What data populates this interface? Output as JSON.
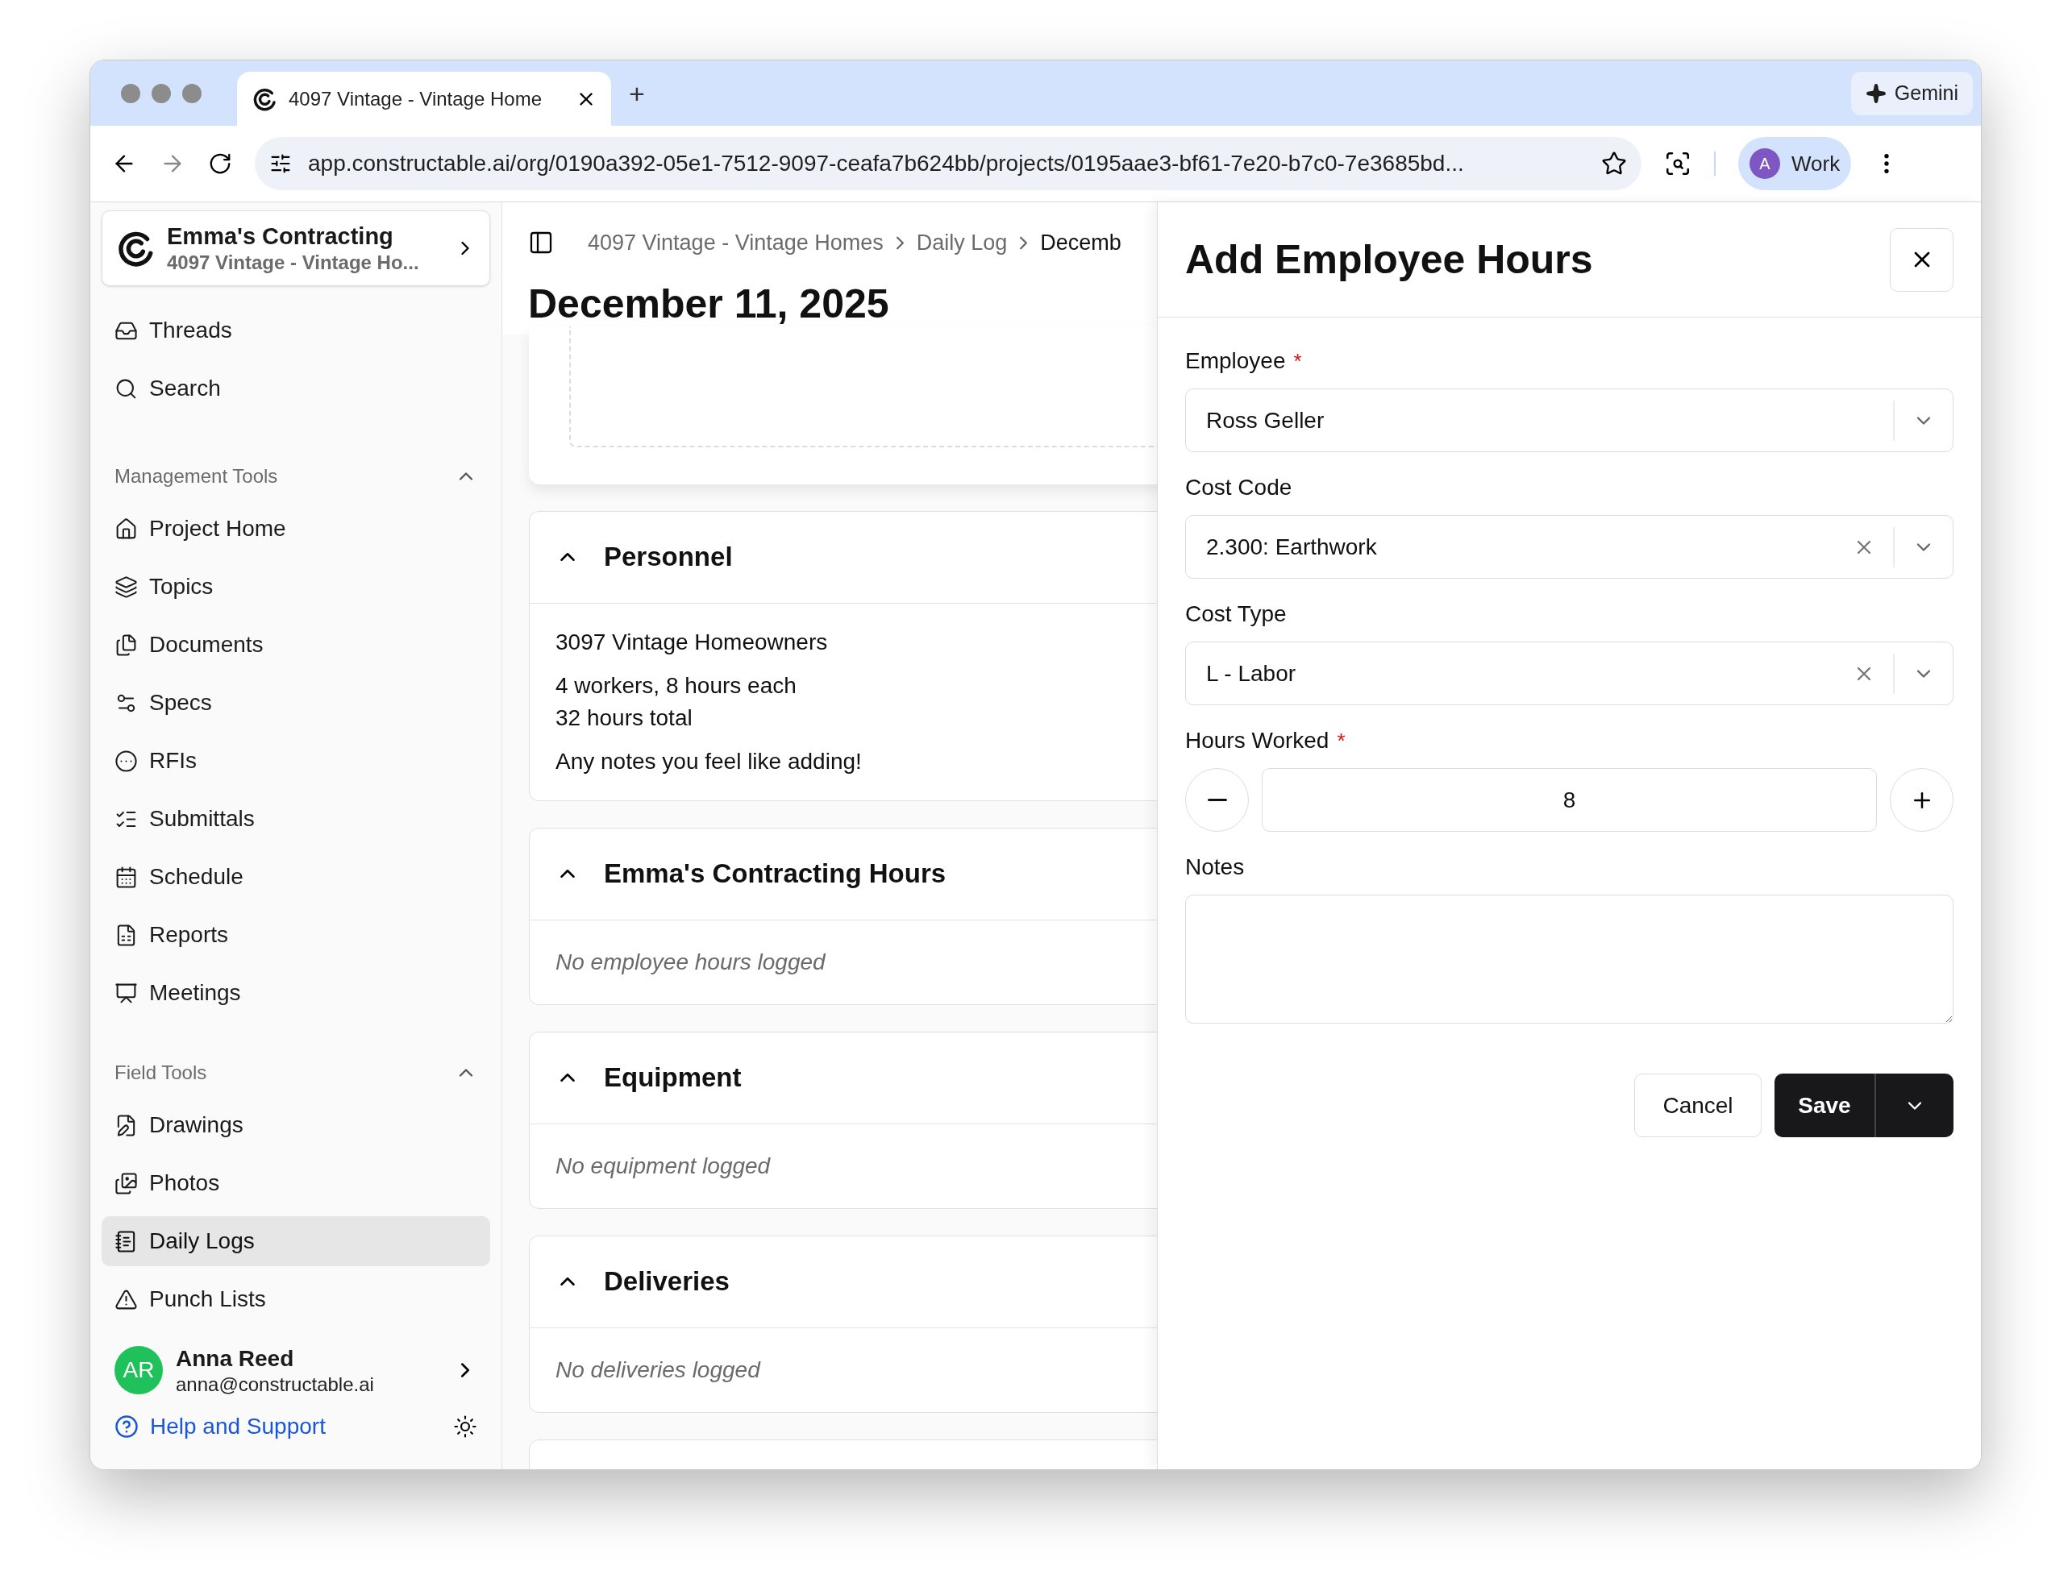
{
  "browser": {
    "tabs": [
      {
        "title": "4097 Vintage - Vintage Home",
        "selected": true
      }
    ],
    "new_tab": "+",
    "gemini": "Gemini",
    "url": "app.constructable.ai/org/0190a392-05e1-7512-9097-ceafa7b624bb/projects/0195aae3-bf61-7e20-b7c0-7e3685bd...",
    "profile": {
      "initial": "A",
      "label": "Work"
    }
  },
  "sidebar": {
    "org": {
      "name": "Emma's Contracting",
      "project": "4097 Vintage - Vintage Ho..."
    },
    "top_items": [
      {
        "label": "Threads",
        "selected": false
      },
      {
        "label": "Search",
        "selected": false
      }
    ],
    "sections": [
      {
        "title": "Management Tools",
        "expanded": true,
        "items": [
          {
            "label": "Project Home",
            "selected": false
          },
          {
            "label": "Topics",
            "selected": false
          },
          {
            "label": "Documents",
            "selected": false
          },
          {
            "label": "Specs",
            "selected": false
          },
          {
            "label": "RFIs",
            "selected": false
          },
          {
            "label": "Submittals",
            "selected": false
          },
          {
            "label": "Schedule",
            "selected": false
          },
          {
            "label": "Reports",
            "selected": false
          },
          {
            "label": "Meetings",
            "selected": false
          }
        ]
      },
      {
        "title": "Field Tools",
        "expanded": true,
        "items": [
          {
            "label": "Drawings",
            "selected": false
          },
          {
            "label": "Photos",
            "selected": false
          },
          {
            "label": "Daily Logs",
            "selected": true
          },
          {
            "label": "Punch Lists",
            "selected": false
          }
        ]
      }
    ],
    "user": {
      "initials": "AR",
      "name": "Anna Reed",
      "email": "anna@constructable.ai"
    },
    "help": "Help and Support"
  },
  "main": {
    "breadcrumbs": [
      "4097 Vintage - Vintage Homes",
      "Daily Log",
      "Decemb"
    ],
    "title": "December 11, 2025",
    "sections": [
      {
        "title": "Personnel",
        "expanded": true,
        "kind": "entries",
        "lines": [
          [
            "3097 Vintage Homeowners"
          ],
          [
            "4 workers, 8 hours each",
            "32 hours total"
          ],
          [
            "Any notes you feel like adding!"
          ]
        ]
      },
      {
        "title": "Emma's Contracting Hours",
        "expanded": true,
        "kind": "empty",
        "message": "No employee hours logged"
      },
      {
        "title": "Equipment",
        "expanded": true,
        "kind": "empty",
        "message": "No equipment logged"
      },
      {
        "title": "Deliveries",
        "expanded": true,
        "kind": "empty",
        "message": "No deliveries logged"
      }
    ]
  },
  "panel": {
    "title": "Add Employee Hours",
    "fields": [
      {
        "kind": "select",
        "label": "Employee",
        "marker": "*",
        "value": "Ross Geller",
        "clearable": false
      },
      {
        "kind": "select",
        "label": "Cost Code",
        "value": "2.300: Earthwork",
        "clearable": true
      },
      {
        "kind": "select",
        "label": "Cost Type",
        "value": "L - Labor",
        "clearable": true
      },
      {
        "kind": "stepper",
        "label": "Hours Worked",
        "marker": "*",
        "value": "8"
      },
      {
        "kind": "textarea",
        "label": "Notes"
      }
    ],
    "cancel": "Cancel",
    "save": "Save"
  }
}
